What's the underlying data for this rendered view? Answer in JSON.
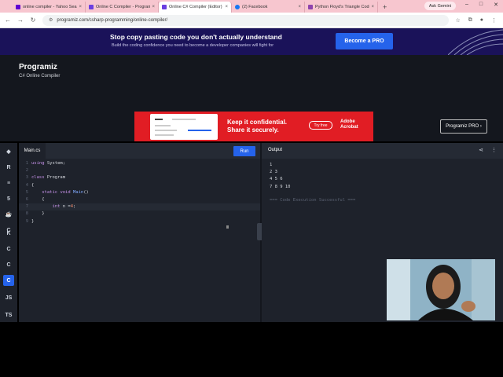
{
  "browser": {
    "tabs": [
      {
        "label": "online compiler - Yahoo Search",
        "color": "#6001d2"
      },
      {
        "label": "Online C Compiler - Programiz",
        "color": "#6b3fe0"
      },
      {
        "label": "Online C# Compiler (Editor)",
        "color": "#6b3fe0",
        "active": true
      },
      {
        "label": "(2) Facebook",
        "color": "#1877f2"
      },
      {
        "label": "Python Floyd's Triangle Code",
        "color": "#8e44ad"
      }
    ],
    "new_tab": "+",
    "ask_gemini": "Ask Gemini",
    "url": "programiz.com/csharp-programming/online-compiler/"
  },
  "promo": {
    "title": "Stop copy pasting code you don't actually understand",
    "subtitle": "Build the coding confidence you need to become a developer companies will fight for",
    "button": "Become a PRO"
  },
  "header": {
    "logo": "Programiz",
    "subtitle": "C# Online Compiler",
    "pro_button": "Programiz PRO ›",
    "ad": {
      "headline": "Keep it confidential. Share it securely.",
      "button": "Try free",
      "brand": "Adobe Acrobat"
    }
  },
  "sidebar": {
    "items": [
      {
        "icon": "python-icon",
        "glyph": "◆"
      },
      {
        "icon": "r-icon",
        "glyph": "R"
      },
      {
        "icon": "sql-icon",
        "glyph": "≡"
      },
      {
        "icon": "html-icon",
        "glyph": "5"
      },
      {
        "icon": "java-icon",
        "glyph": "☕"
      },
      {
        "icon": "c-icon",
        "glyph": "C"
      },
      {
        "icon": "kotlin-icon",
        "glyph": "K"
      },
      {
        "icon": "c-lang-icon",
        "glyph": "C"
      },
      {
        "icon": "cpp-icon",
        "glyph": "C"
      },
      {
        "icon": "csharp-icon",
        "glyph": "C",
        "selected": true
      },
      {
        "icon": "javascript-icon",
        "glyph": "JS"
      },
      {
        "icon": "typescript-icon",
        "glyph": "TS"
      }
    ]
  },
  "editor": {
    "filename": "Main.cs",
    "run_label": "Run",
    "lines": [
      "1",
      "2",
      "3",
      "4",
      "5",
      "6",
      "7",
      "8",
      "9"
    ]
  },
  "output": {
    "label": "Output",
    "lines": [
      "1",
      "2 3",
      "4 5 6",
      "7 8 9 10"
    ],
    "status": "=== Code Execution Successful ==="
  }
}
